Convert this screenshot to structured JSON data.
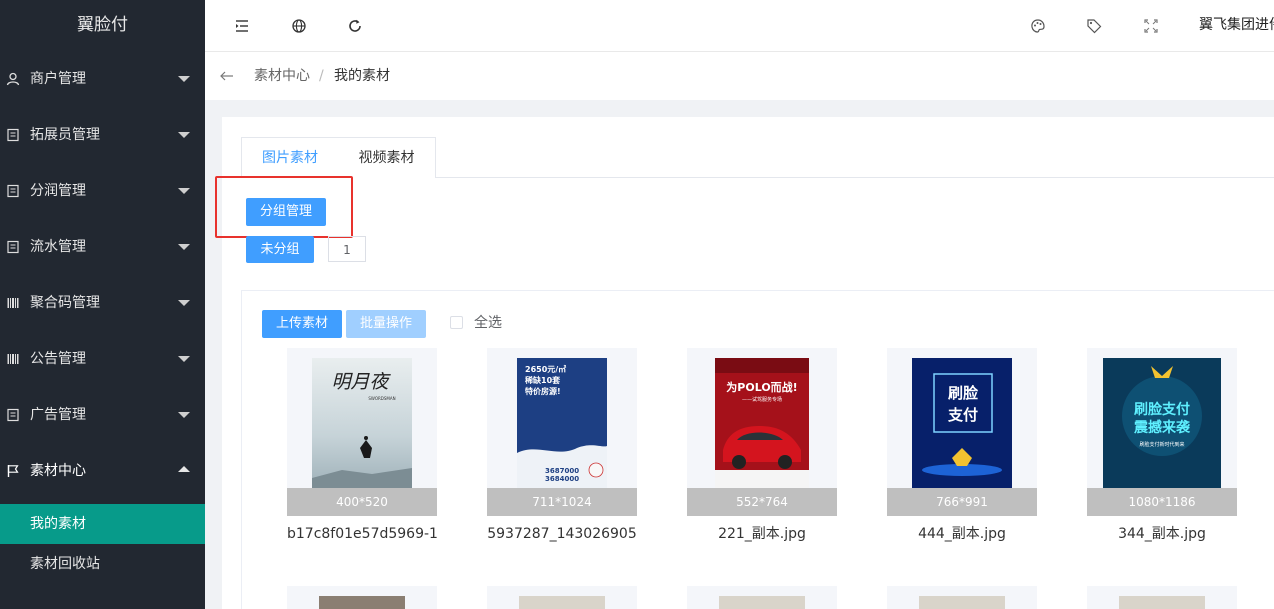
{
  "sidebar": {
    "logo": "翼脸付",
    "menu": [
      {
        "label": "商户管理",
        "icon": "user-icon"
      },
      {
        "label": "拓展员管理",
        "icon": "document-icon"
      },
      {
        "label": "分润管理",
        "icon": "document-icon"
      },
      {
        "label": "流水管理",
        "icon": "document-icon"
      },
      {
        "label": "聚合码管理",
        "icon": "barcode-icon"
      },
      {
        "label": "公告管理",
        "icon": "barcode-icon"
      },
      {
        "label": "广告管理",
        "icon": "document-icon"
      },
      {
        "label": "素材中心",
        "icon": "flag-icon"
      }
    ],
    "submenu": [
      {
        "label": "我的素材",
        "active": true
      },
      {
        "label": "素材回收站",
        "active": false
      }
    ]
  },
  "topbar": {
    "icons": [
      "menu-fold-icon",
      "globe-icon",
      "refresh-icon",
      "palette-icon",
      "tag-icon",
      "fullscreen-icon"
    ],
    "user": "翼飞集团进件"
  },
  "breadcrumb": {
    "root": "素材中心",
    "separator": "/",
    "current": "我的素材"
  },
  "tabs": [
    "图片素材",
    "视频素材"
  ],
  "buttons": {
    "group_manage": "分组管理",
    "ungrouped": "未分组",
    "ungrouped_count": "1",
    "upload": "上传素材",
    "batch": "批量操作",
    "select_all": "全选"
  },
  "materials": [
    {
      "dim": "400*520",
      "name": "b17c8f01e57d5969-1"
    },
    {
      "dim": "711*1024",
      "name": "5937287_143026905"
    },
    {
      "dim": "552*764",
      "name": "221_副本.jpg"
    },
    {
      "dim": "766*991",
      "name": "444_副本.jpg"
    },
    {
      "dim": "1080*1186",
      "name": "344_副本.jpg"
    }
  ],
  "posters": {
    "p1": {
      "title": "明月夜",
      "sub": "SWORDSMAN"
    },
    "p2": {
      "line1": "2650元/㎡",
      "line2": "稀缺10套",
      "line3": "特价房源!",
      "phone1": "3687000",
      "phone2": "3684000"
    },
    "p3": {
      "title": "为POLO而战!",
      "sub": "——试驾服务专场"
    },
    "p4": {
      "line1": "刷脸",
      "line2": "支付"
    },
    "p5": {
      "line1": "刷脸支付",
      "line2": "震撼来袭",
      "line3": "刷脸支付新时代到来"
    }
  },
  "colors": {
    "sidebar_bg": "#222831",
    "active_menu": "#079b8a",
    "primary": "#409eff",
    "highlight_box": "#e8322d"
  }
}
